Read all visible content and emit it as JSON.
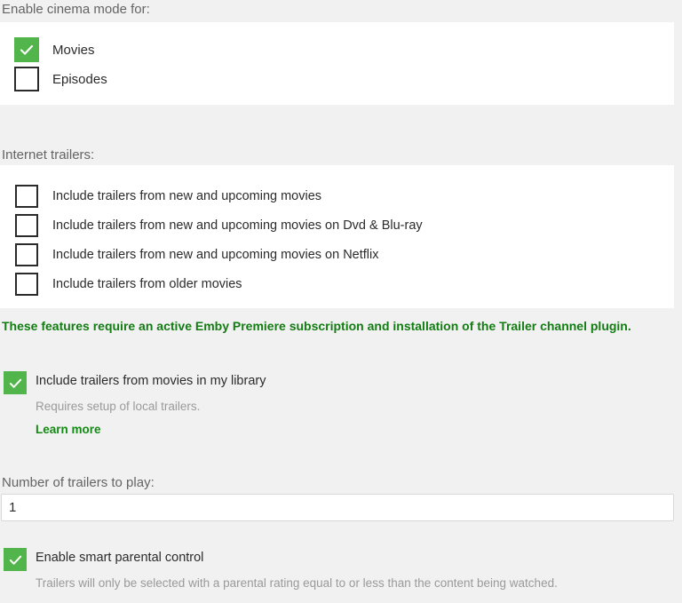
{
  "colors": {
    "page_background": "#f1f1f1",
    "panel_background": "#ffffff",
    "checkbox_checked_fill": "#52b54b",
    "checkbox_unchecked_border": "#2a2a2a",
    "notice_green": "#137c13",
    "link_green": "#138a13",
    "heading_gray": "#646464",
    "helper_gray": "#9a9a9a",
    "label_dark": "#2b2b2b"
  },
  "cinema_mode": {
    "heading": "Enable cinema mode for:",
    "options": [
      {
        "label": "Movies",
        "checked": true,
        "icon": "checkmark-icon"
      },
      {
        "label": "Episodes",
        "checked": false,
        "icon": "empty-checkbox-icon"
      }
    ]
  },
  "internet_trailers": {
    "heading": "Internet trailers:",
    "options": [
      {
        "label": "Include trailers from new and upcoming movies",
        "checked": false
      },
      {
        "label": "Include trailers from new and upcoming movies on Dvd & Blu-ray",
        "checked": false
      },
      {
        "label": "Include trailers from new and upcoming movies on Netflix",
        "checked": false
      },
      {
        "label": "Include trailers from older movies",
        "checked": false
      }
    ],
    "notice": "These features require an active Emby Premiere subscription and installation of the Trailer channel plugin."
  },
  "library_trailers": {
    "label": "Include trailers from movies in my library",
    "checked": true,
    "description": "Requires setup of local trailers.",
    "link_label": "Learn more"
  },
  "number_of_trailers": {
    "heading": "Number of trailers to play:",
    "value": "1",
    "placeholder": ""
  },
  "parental_control": {
    "label": "Enable smart parental control",
    "checked": true,
    "description": "Trailers will only be selected with a parental rating equal to or less than the content being watched."
  }
}
